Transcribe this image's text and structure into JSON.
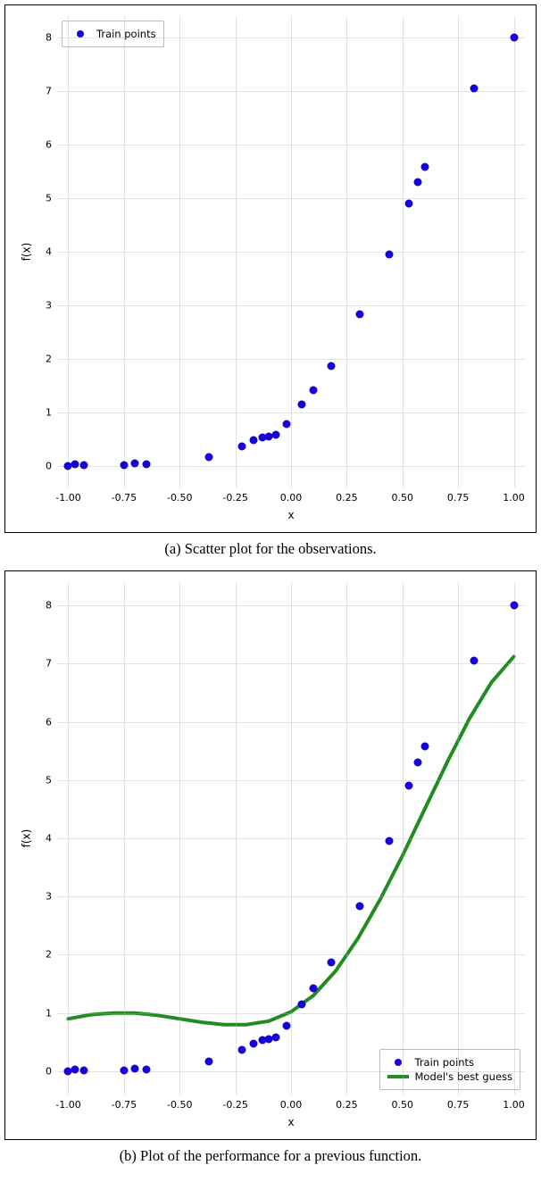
{
  "chart_data": [
    {
      "type": "scatter",
      "caption": "(a) Scatter plot for the observations.",
      "xlabel": "x",
      "ylabel": "f(x)",
      "xlim": [
        -1.05,
        1.05
      ],
      "ylim": [
        -0.4,
        8.4
      ],
      "xticks": [
        -1.0,
        -0.75,
        -0.5,
        -0.25,
        0.0,
        0.25,
        0.5,
        0.75,
        1.0
      ],
      "yticks": [
        0,
        1,
        2,
        3,
        4,
        5,
        6,
        7,
        8
      ],
      "legend": {
        "items": [
          {
            "label": "Train points",
            "marker": "dot"
          }
        ],
        "position": "top-left"
      },
      "series": [
        {
          "name": "Train points",
          "color": "#1500d5",
          "points": [
            {
              "x": -1.0,
              "y": 0.0
            },
            {
              "x": -0.97,
              "y": 0.03
            },
            {
              "x": -0.93,
              "y": 0.02
            },
            {
              "x": -0.75,
              "y": 0.02
            },
            {
              "x": -0.7,
              "y": 0.05
            },
            {
              "x": -0.65,
              "y": 0.03
            },
            {
              "x": -0.37,
              "y": 0.17
            },
            {
              "x": -0.22,
              "y": 0.37
            },
            {
              "x": -0.17,
              "y": 0.48
            },
            {
              "x": -0.13,
              "y": 0.53
            },
            {
              "x": -0.1,
              "y": 0.55
            },
            {
              "x": -0.07,
              "y": 0.58
            },
            {
              "x": -0.02,
              "y": 0.78
            },
            {
              "x": 0.05,
              "y": 1.15
            },
            {
              "x": 0.1,
              "y": 1.42
            },
            {
              "x": 0.18,
              "y": 1.87
            },
            {
              "x": 0.31,
              "y": 2.83
            },
            {
              "x": 0.44,
              "y": 3.95
            },
            {
              "x": 0.53,
              "y": 4.9
            },
            {
              "x": 0.57,
              "y": 5.3
            },
            {
              "x": 0.6,
              "y": 5.58
            },
            {
              "x": 0.82,
              "y": 7.05
            },
            {
              "x": 1.0,
              "y": 8.0
            }
          ]
        }
      ]
    },
    {
      "type": "scatter+line",
      "caption": "(b) Plot of the performance for a previous function.",
      "xlabel": "x",
      "ylabel": "f(x)",
      "xlim": [
        -1.05,
        1.05
      ],
      "ylim": [
        -0.4,
        8.4
      ],
      "xticks": [
        -1.0,
        -0.75,
        -0.5,
        -0.25,
        0.0,
        0.25,
        0.5,
        0.75,
        1.0
      ],
      "yticks": [
        0,
        1,
        2,
        3,
        4,
        5,
        6,
        7,
        8
      ],
      "legend": {
        "items": [
          {
            "label": "Train points",
            "marker": "dot"
          },
          {
            "label": "Model's best guess",
            "marker": "line"
          }
        ],
        "position": "bottom-right"
      },
      "series": [
        {
          "name": "Train points",
          "color": "#1500d5",
          "points": [
            {
              "x": -1.0,
              "y": 0.0
            },
            {
              "x": -0.97,
              "y": 0.03
            },
            {
              "x": -0.93,
              "y": 0.02
            },
            {
              "x": -0.75,
              "y": 0.02
            },
            {
              "x": -0.7,
              "y": 0.05
            },
            {
              "x": -0.65,
              "y": 0.03
            },
            {
              "x": -0.37,
              "y": 0.17
            },
            {
              "x": -0.22,
              "y": 0.37
            },
            {
              "x": -0.17,
              "y": 0.48
            },
            {
              "x": -0.13,
              "y": 0.53
            },
            {
              "x": -0.1,
              "y": 0.55
            },
            {
              "x": -0.07,
              "y": 0.58
            },
            {
              "x": -0.02,
              "y": 0.78
            },
            {
              "x": 0.05,
              "y": 1.15
            },
            {
              "x": 0.1,
              "y": 1.42
            },
            {
              "x": 0.18,
              "y": 1.87
            },
            {
              "x": 0.31,
              "y": 2.83
            },
            {
              "x": 0.44,
              "y": 3.95
            },
            {
              "x": 0.53,
              "y": 4.9
            },
            {
              "x": 0.57,
              "y": 5.3
            },
            {
              "x": 0.6,
              "y": 5.58
            },
            {
              "x": 0.82,
              "y": 7.05
            },
            {
              "x": 1.0,
              "y": 8.0
            }
          ]
        },
        {
          "name": "Model's best guess",
          "color": "#228B22",
          "type": "line",
          "points": [
            {
              "x": -1.0,
              "y": 0.9
            },
            {
              "x": -0.9,
              "y": 0.97
            },
            {
              "x": -0.8,
              "y": 1.0
            },
            {
              "x": -0.7,
              "y": 1.0
            },
            {
              "x": -0.6,
              "y": 0.96
            },
            {
              "x": -0.5,
              "y": 0.9
            },
            {
              "x": -0.4,
              "y": 0.84
            },
            {
              "x": -0.3,
              "y": 0.8
            },
            {
              "x": -0.2,
              "y": 0.8
            },
            {
              "x": -0.1,
              "y": 0.86
            },
            {
              "x": 0.0,
              "y": 1.02
            },
            {
              "x": 0.1,
              "y": 1.3
            },
            {
              "x": 0.2,
              "y": 1.72
            },
            {
              "x": 0.3,
              "y": 2.28
            },
            {
              "x": 0.4,
              "y": 2.95
            },
            {
              "x": 0.5,
              "y": 3.7
            },
            {
              "x": 0.6,
              "y": 4.5
            },
            {
              "x": 0.7,
              "y": 5.3
            },
            {
              "x": 0.8,
              "y": 6.05
            },
            {
              "x": 0.9,
              "y": 6.68
            },
            {
              "x": 1.0,
              "y": 7.12
            }
          ]
        }
      ]
    }
  ]
}
